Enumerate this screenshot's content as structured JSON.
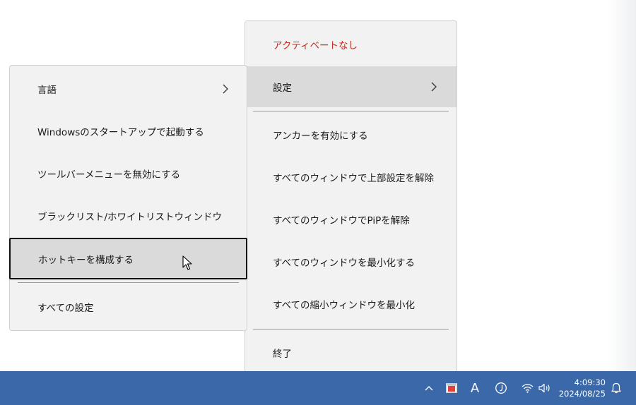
{
  "main_menu": {
    "items": [
      {
        "label": "アクティベートなし"
      },
      {
        "label": "設定"
      },
      {
        "label": "アンカーを有効にする"
      },
      {
        "label": "すべてのウィンドウで上部設定を解除"
      },
      {
        "label": "すべてのウィンドウでPiPを解除"
      },
      {
        "label": "すべてのウィンドウを最小化する"
      },
      {
        "label": "すべての縮小ウィンドウを最小化"
      },
      {
        "label": "終了"
      }
    ]
  },
  "settings_submenu": {
    "items": [
      {
        "label": "言語"
      },
      {
        "label": "Windowsのスタートアップで起動する"
      },
      {
        "label": "ツールバーメニューを無効にする"
      },
      {
        "label": "ブラックリスト/ホワイトリストウィンドウ"
      },
      {
        "label": "ホットキーを構成する"
      },
      {
        "label": "すべての設定"
      }
    ]
  },
  "taskbar": {
    "ime_indicator": "A",
    "time": "4:09:30",
    "date": "2024/08/25",
    "icons": [
      "chevron-up-icon",
      "app-tray-icon",
      "ime-mode-icon",
      "ime-status-icon",
      "wifi-icon",
      "volume-icon",
      "notification-bell-icon"
    ]
  },
  "colors": {
    "menu_background": "#f2f2f2",
    "highlight": "#dadada",
    "danger_text": "#c42b1c",
    "taskbar": "#3b68a8"
  }
}
